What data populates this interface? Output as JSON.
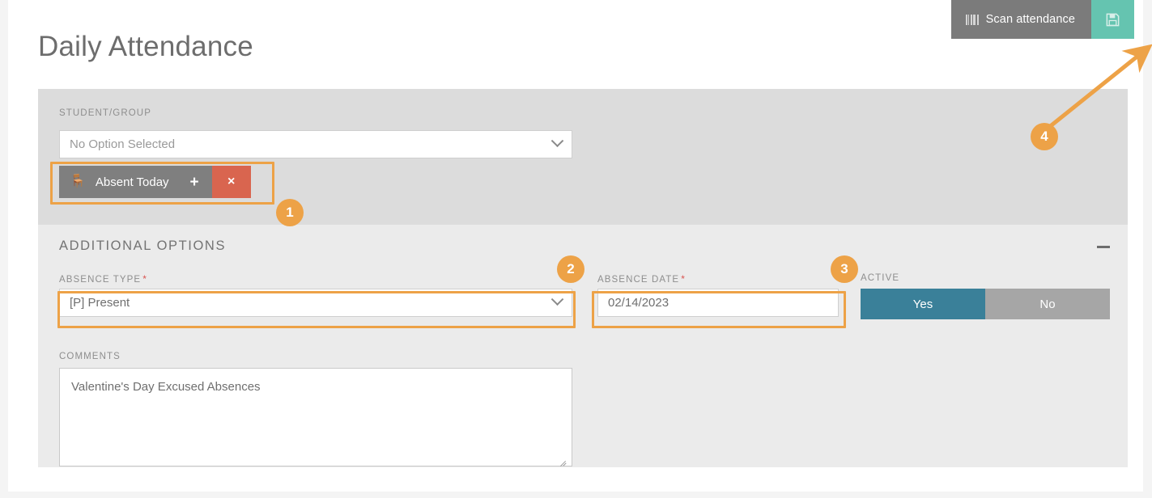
{
  "page": {
    "title": "Daily Attendance"
  },
  "toolbar": {
    "scan_label": "Scan attendance",
    "scan_icon": "barcode-icon",
    "save_icon": "floppy-disk-save-icon",
    "scan_bg": "#7b7b7b",
    "save_bg": "#65c4b0"
  },
  "student_section": {
    "label": "STUDENT/GROUP",
    "select_value": "No Option Selected",
    "chip": {
      "icon": "chair-icon",
      "glyph": "🪑",
      "label": "Absent Today",
      "add_label": "+",
      "remove_label": "×",
      "bg": "#7f7f7f",
      "remove_bg": "#d9654f"
    },
    "bg": "#dcdcdc"
  },
  "options_section": {
    "heading": "ADDITIONAL OPTIONS",
    "collapse_icon": "minus-collapse-icon",
    "bg": "#ebebeb",
    "absence_type": {
      "label": "ABSENCE TYPE",
      "required_marker": "*",
      "value": "[P] Present"
    },
    "absence_date": {
      "label": "ABSENCE DATE",
      "required_marker": "*",
      "value": "02/14/2023"
    },
    "active": {
      "label": "ACTIVE",
      "yes_label": "Yes",
      "no_label": "No",
      "selected": "Yes",
      "on_color": "#3a8099",
      "off_color": "#a6a6a6"
    },
    "comments": {
      "label": "COMMENTS",
      "value": "Valentine's Day Excused Absences"
    }
  },
  "annotations": {
    "color": "#eda247",
    "badges": [
      {
        "number": "1",
        "target": "absent-today-chip"
      },
      {
        "number": "2",
        "target": "absence-type-select"
      },
      {
        "number": "3",
        "target": "absence-date-input"
      },
      {
        "number": "4",
        "target": "save-button"
      }
    ]
  }
}
